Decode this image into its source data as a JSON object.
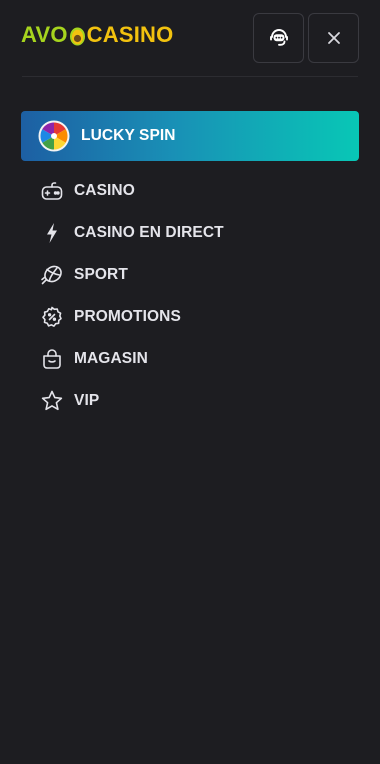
{
  "header": {
    "logo_left": "AVO",
    "logo_right": "CASINO",
    "support_icon": "chat-support-icon",
    "close_icon": "close-icon"
  },
  "lucky_spin": {
    "label": "LUCKY SPIN",
    "icon": "fortune-wheel-icon"
  },
  "menu": {
    "items": [
      {
        "label": "CASINO",
        "icon": "gamepad-icon"
      },
      {
        "label": "CASINO EN DIRECT",
        "icon": "lightning-icon"
      },
      {
        "label": "SPORT",
        "icon": "ball-icon"
      },
      {
        "label": "PROMOTIONS",
        "icon": "percent-badge-icon"
      },
      {
        "label": "MAGASIN",
        "icon": "shopping-bag-icon"
      },
      {
        "label": "VIP",
        "icon": "star-icon"
      }
    ]
  },
  "colors": {
    "background": "#1d1d21",
    "logo_green": "#a6d41e",
    "logo_yellow": "#f2c20f",
    "lucky_gradient_start": "#1d5fa3",
    "lucky_gradient_end": "#08c7b6"
  }
}
